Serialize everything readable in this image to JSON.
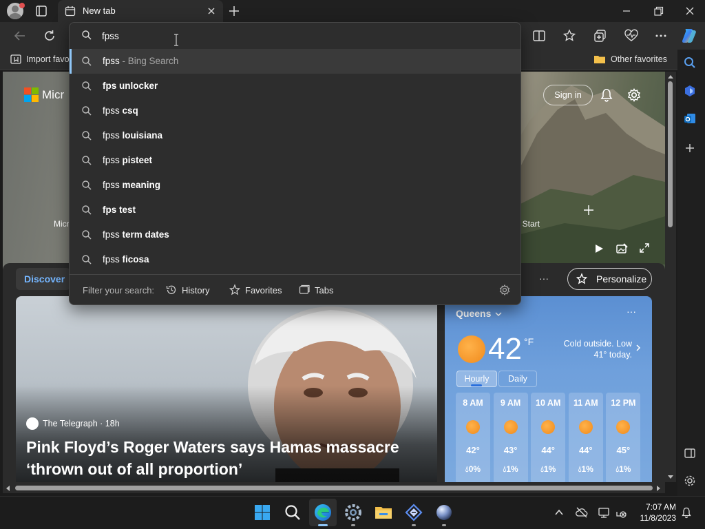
{
  "tab": {
    "title": "New tab"
  },
  "address": {
    "value": "fpss"
  },
  "favorites_bar": {
    "import_label": "Import favo",
    "other_favorites": "Other favorites"
  },
  "suggestions": [
    {
      "prefix": "fpss",
      "bold": "",
      "suffix": " - Bing Search",
      "selected": true
    },
    {
      "prefix": "",
      "bold": "fps unlocker",
      "suffix": ""
    },
    {
      "prefix": "fpss ",
      "bold": "csq",
      "suffix": ""
    },
    {
      "prefix": "fpss ",
      "bold": "louisiana",
      "suffix": ""
    },
    {
      "prefix": "fpss ",
      "bold": "pisteet",
      "suffix": ""
    },
    {
      "prefix": "fpss ",
      "bold": "meaning",
      "suffix": ""
    },
    {
      "prefix": "",
      "bold": "fps test",
      "suffix": ""
    },
    {
      "prefix": "fpss ",
      "bold": "term dates",
      "suffix": ""
    },
    {
      "prefix": "fpss ",
      "bold": "ficosa",
      "suffix": ""
    }
  ],
  "filter": {
    "label": "Filter your search:",
    "history": "History",
    "favorites": "Favorites",
    "tabs": "Tabs"
  },
  "ntp": {
    "brand_partial": "Micr",
    "tile_left": "Micr",
    "tile_right": "t Start",
    "sign_in": "Sign in",
    "discover": "Discover",
    "more": "···",
    "personalize": "Personalize"
  },
  "news": {
    "source": "The Telegraph · 18h",
    "headline": "Pink Floyd’s Roger Waters says Hamas massacre ‘thrown out of all proportion’"
  },
  "weather": {
    "city": "Queens",
    "temp": "42",
    "unit": "°F",
    "note": "Cold outside. Low 41° today.",
    "tab_hourly": "Hourly",
    "tab_daily": "Daily",
    "more": "···",
    "hours": [
      {
        "time": "8 AM",
        "temp": "42°",
        "precip": "0%"
      },
      {
        "time": "9 AM",
        "temp": "43°",
        "precip": "1%"
      },
      {
        "time": "10 AM",
        "temp": "44°",
        "precip": "1%"
      },
      {
        "time": "11 AM",
        "temp": "44°",
        "precip": "1%"
      },
      {
        "time": "12 PM",
        "temp": "45°",
        "precip": "1%"
      }
    ]
  },
  "taskbar": {
    "time": "7:07 AM",
    "date": "11/8/2023"
  },
  "colors": {
    "accent": "#8fc6f7",
    "discover": "#75b6ff",
    "sun": "#f08a1c"
  }
}
